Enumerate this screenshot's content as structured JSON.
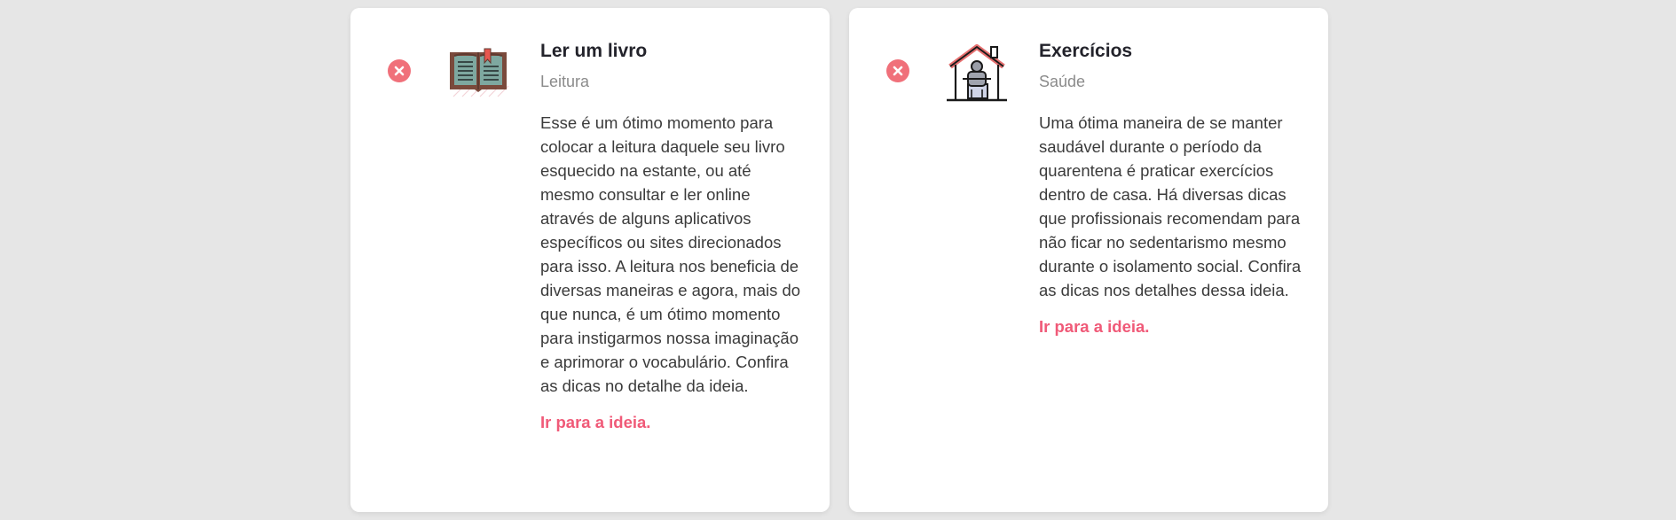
{
  "colors": {
    "background": "#e6e6e6",
    "card": "#ffffff",
    "title": "#23232b",
    "category": "#8b8b8b",
    "text": "#3b3b3b",
    "link": "#f05a78",
    "remove": "#f0707a"
  },
  "ideas": [
    {
      "title": "Ler um livro",
      "category": "Leitura",
      "icon": "open-book-icon",
      "description": "Esse é um ótimo momento para colocar a leitura daquele seu livro esquecido na estante, ou até mesmo consultar e ler online através de alguns aplicativos específicos ou sites direcionados para isso. A leitura nos beneficia de diversas maneiras e agora, mais do que nunca, é um ótimo momento para instigarmos nossa imaginação e aprimorar o vocabulário. Confira as dicas no detalhe da ideia.",
      "link": "Ir para a ideia."
    },
    {
      "title": "Exercícios",
      "category": "Saúde",
      "icon": "home-workout-icon",
      "description": "Uma ótima maneira de se manter saudável durante o período da quarentena é praticar exercícios dentro de casa. Há diversas dicas que profissionais recomendam para não ficar no sedentarismo mesmo durante o isolamento social. Confira as dicas nos detalhes dessa ideia.",
      "link": "Ir para a ideia."
    }
  ]
}
